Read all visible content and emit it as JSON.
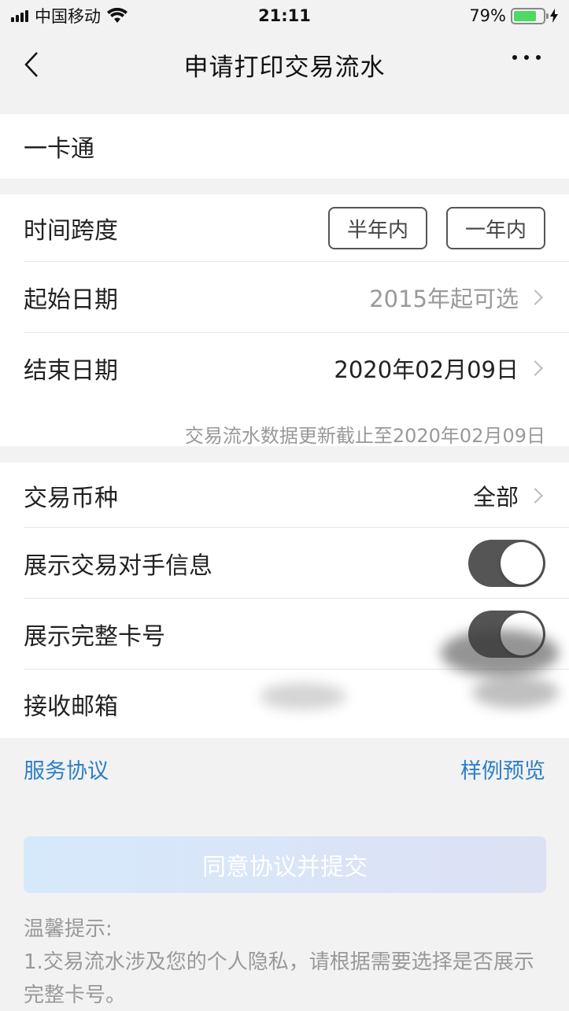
{
  "status": {
    "carrier": "中国移动",
    "time": "21:11",
    "battery": "79%",
    "battery_level": 0.79
  },
  "nav": {
    "title": "申请打印交易流水"
  },
  "card": {
    "label": "一卡通"
  },
  "period": {
    "label": "时间跨度",
    "options": [
      "半年内",
      "一年内"
    ],
    "start_label": "起始日期",
    "start_value": "2015年起可选",
    "end_label": "结束日期",
    "end_value": "2020年02月09日",
    "note": "交易流水数据更新截止至2020年02月09日"
  },
  "options": {
    "currency_label": "交易币种",
    "currency_value": "全部",
    "show_counterparty_label": "展示交易对手信息",
    "show_counterparty_on": true,
    "show_full_card_label": "展示完整卡号",
    "show_full_card_on": true,
    "email_label": "接收邮箱"
  },
  "links": {
    "agreement": "服务协议",
    "sample": "样例预览"
  },
  "submit": {
    "label": "同意协议并提交"
  },
  "tips": {
    "title": "温馨提示:",
    "line1": "1.交易流水涉及您的个人隐私，请根据需要选择是否展示完整卡号。"
  },
  "colors": {
    "link": "#2c7fc6",
    "toggle_on": "#555555",
    "battery": "#4cd964"
  }
}
